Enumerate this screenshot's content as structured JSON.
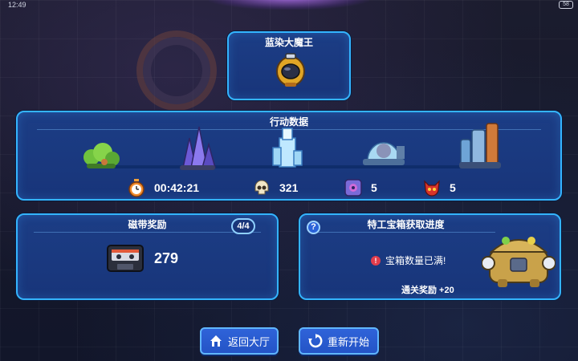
{
  "status_bar": {
    "time": "12:49",
    "battery": "58"
  },
  "boss": {
    "name": "蓝染大魔王",
    "icon": "golden-helmet-boss-icon"
  },
  "action_data": {
    "title": "行动数据",
    "stages": [
      "forest-stage-icon",
      "crystal-stage-icon",
      "ice-tower-stage-icon",
      "dome-stage-icon",
      "factory-stage-icon"
    ],
    "stats": {
      "time": {
        "icon": "stopwatch-icon",
        "value": "00:42:21"
      },
      "kills": {
        "icon": "skull-icon",
        "value": "321"
      },
      "elites": {
        "icon": "elite-monster-icon",
        "value": "5"
      },
      "bosses": {
        "icon": "demon-head-icon",
        "value": "5"
      }
    }
  },
  "tape_reward": {
    "title": "磁带奖励",
    "icon": "cassette-tape-icon",
    "value": "279"
  },
  "chest_progress": {
    "title": "特工宝箱获取进度",
    "help": "?",
    "count": "4/4",
    "warning": "宝箱数量已满!",
    "clear_reward": "通关奖励 +20",
    "icon": "agent-chest-icon"
  },
  "buttons": {
    "home": "返回大厅",
    "restart": "重新开始"
  }
}
